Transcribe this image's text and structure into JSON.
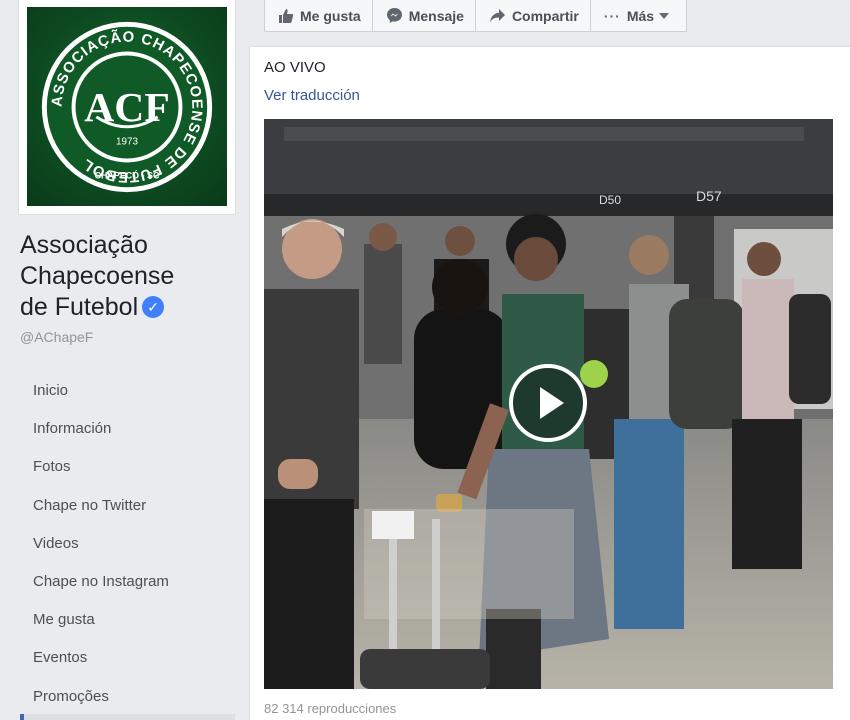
{
  "page": {
    "name_line1": "Associação",
    "name_line2": "Chapecoense",
    "name_line3": "de Futebol",
    "handle": "@AChapeF",
    "verified_icon": "check-icon"
  },
  "logo": {
    "ring_text": "ASSOCIAÇÃO CHAPECOENSE DE FUTEBOL",
    "monogram": "ACF",
    "year": "1973",
    "city": "CHAPECÓ - SC"
  },
  "nav": {
    "items": [
      {
        "label": "Inicio"
      },
      {
        "label": "Información"
      },
      {
        "label": "Fotos"
      },
      {
        "label": "Chape no Twitter"
      },
      {
        "label": "Videos"
      },
      {
        "label": "Chape no Instagram"
      },
      {
        "label": "Me gusta"
      },
      {
        "label": "Eventos"
      },
      {
        "label": "Promoções"
      }
    ]
  },
  "actions": {
    "like": "Me gusta",
    "message": "Mensaje",
    "share": "Compartir",
    "more": "Más"
  },
  "post": {
    "text": "AO VIVO",
    "translate": "Ver traducción",
    "views": "82 314 reproducciones",
    "gate_sign_1": "D50",
    "gate_sign_2": "D57"
  },
  "colors": {
    "link": "#365899",
    "brand_blue": "#4267b2",
    "logo_green": "#0d4a20"
  }
}
